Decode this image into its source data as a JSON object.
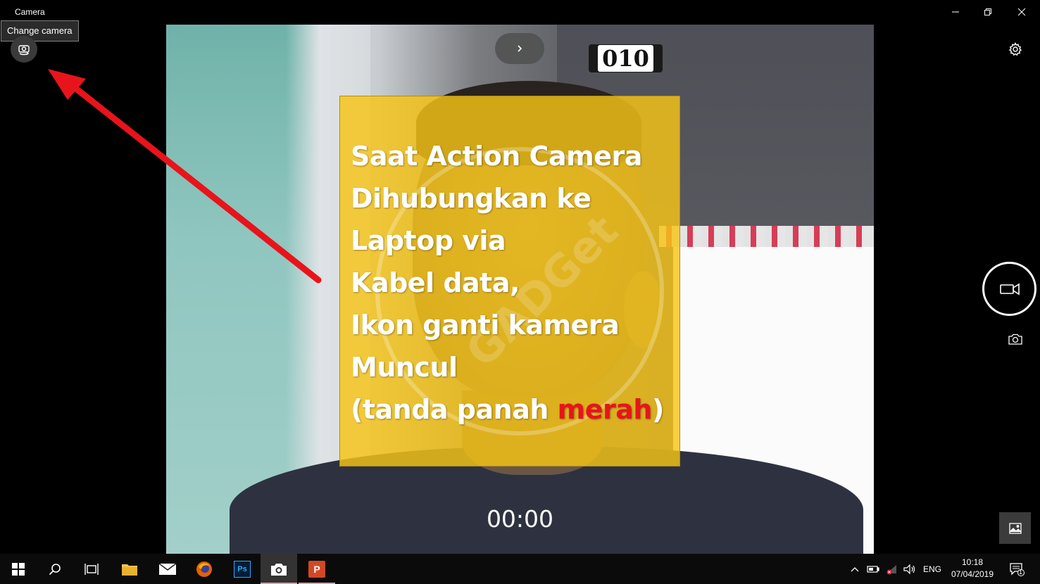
{
  "window": {
    "title": "Camera",
    "tooltip": "Change camera"
  },
  "viewport": {
    "counter_sign": "010",
    "timer": "00:00"
  },
  "annotation": {
    "line1": "Saat Action Camera",
    "line2": "Dihubungkan ke",
    "line3": "Laptop via",
    "line4": "Kabel data,",
    "line5": "Ikon ganti kamera",
    "line6": "Muncul",
    "line7_prefix": "(tanda panah ",
    "line7_red": "merah",
    "line7_suffix": ")",
    "watermark": "GADGet",
    "highlight_color": "#e8141b",
    "box_color": "#f7c516"
  },
  "controls": {
    "change_camera_icon": "camera-switch-icon",
    "settings_icon": "gear-icon",
    "record_icon": "video-camera-icon",
    "photo_icon": "camera-icon",
    "gallery_icon": "image-icon"
  },
  "taskbar": {
    "apps": [
      "start",
      "search",
      "task-view",
      "file-explorer",
      "mail",
      "firefox",
      "photoshop",
      "camera",
      "powerpoint"
    ],
    "photoshop_label": "Ps",
    "powerpoint_label": "P",
    "language": "ENG",
    "time": "10:18",
    "date": "07/04/2019",
    "notification_count": "1"
  }
}
